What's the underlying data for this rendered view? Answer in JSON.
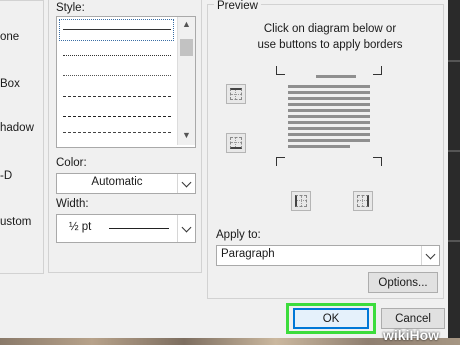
{
  "setting": {
    "options": [
      "one",
      "Box",
      "hadow",
      "-D",
      "ustom"
    ]
  },
  "style": {
    "label": "Style:",
    "line_styles": [
      "solid",
      "dotted",
      "dashed-fine",
      "dashed-small",
      "dashed-medium",
      "dash-dot"
    ]
  },
  "color": {
    "label": "Color:",
    "value": "Automatic"
  },
  "width": {
    "label": "Width:",
    "value": "½ pt"
  },
  "preview": {
    "legend": "Preview",
    "instructions_line1": "Click on diagram below or",
    "instructions_line2": "use buttons to apply borders"
  },
  "apply_to": {
    "label": "Apply to:",
    "value": "Paragraph"
  },
  "buttons": {
    "options": "Options...",
    "ok": "OK",
    "cancel": "Cancel"
  },
  "watermark": {
    "wiki": "wiki",
    "how": "How"
  },
  "colors": {
    "dialog_bg": "#f0f0f0",
    "highlight": "#3cdc3c",
    "focus_blue": "#0078d7"
  }
}
